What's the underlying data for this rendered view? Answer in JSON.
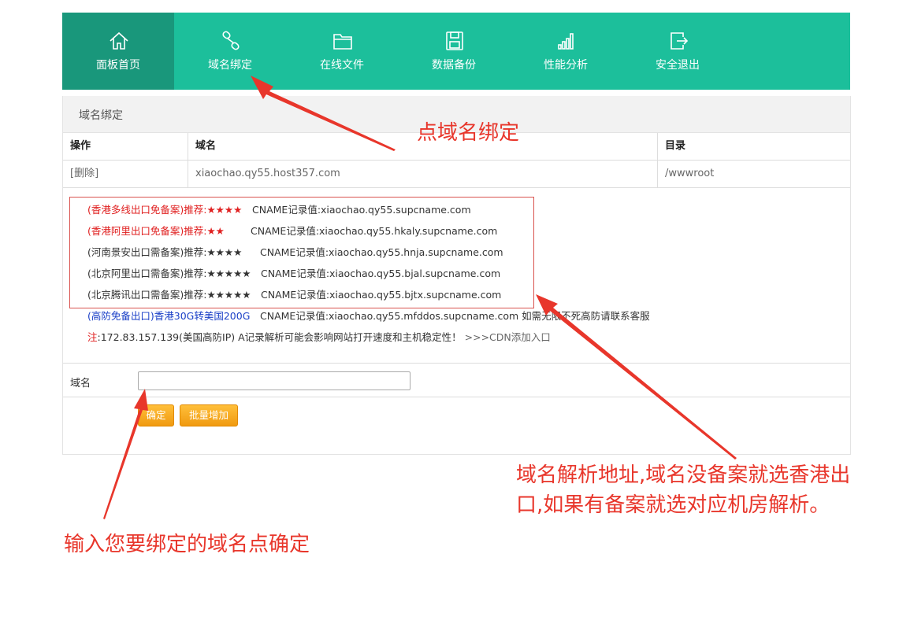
{
  "nav": {
    "items": [
      {
        "label": "面板首页",
        "icon": "home-icon"
      },
      {
        "label": "域名绑定",
        "icon": "link-icon"
      },
      {
        "label": "在线文件",
        "icon": "folder-icon"
      },
      {
        "label": "数据备份",
        "icon": "save-icon"
      },
      {
        "label": "性能分析",
        "icon": "signal-icon"
      },
      {
        "label": "安全退出",
        "icon": "logout-icon"
      }
    ],
    "active_index": 0,
    "bg_color": "#1cbf9b",
    "active_color": "#19977b"
  },
  "panel": {
    "title": "域名绑定",
    "table": {
      "headers": [
        "操作",
        "域名",
        "目录"
      ],
      "rows": [
        {
          "action": "[删除]",
          "domain": "xiaochao.qy55.host357.com",
          "dir": "/wwwroot"
        }
      ]
    },
    "cname_lines": [
      {
        "prefix": "(香港多线出口免备案)推荐:★★★★",
        "cname": "CNAME记录值:xiaochao.qy55.supcname.com",
        "color": "red"
      },
      {
        "prefix": "(香港阿里出口免备案)推荐:★★",
        "cname": "CNAME记录值:xiaochao.qy55.hkaly.supcname.com",
        "color": "red"
      },
      {
        "prefix": "(河南景安出口需备案)推荐:★★★★",
        "cname": "CNAME记录值:xiaochao.qy55.hnja.supcname.com",
        "color": "dark"
      },
      {
        "prefix": "(北京阿里出口需备案)推荐:★★★★★",
        "cname": "CNAME记录值:xiaochao.qy55.bjal.supcname.com",
        "color": "dark"
      },
      {
        "prefix": "(北京腾讯出口需备案)推荐:★★★★★",
        "cname": "CNAME记录值:xiaochao.qy55.bjtx.supcname.com",
        "color": "dark"
      }
    ],
    "ddos_line": {
      "prefix": "(高防免备出口)香港30G转美国200G",
      "cname": "CNAME记录值:xiaochao.qy55.mfddos.supcname.com 如需无限不死高防请联系客服"
    },
    "note": {
      "label": "注",
      "text": ":172.83.157.139(美国高防IP) A记录解析可能会影响网站打开速度和主机稳定性！",
      "link": ">>>CDN添加入口"
    },
    "form": {
      "domain_label": "域名",
      "domain_value": "",
      "confirm_label": "确定",
      "batch_label": "批量增加"
    }
  },
  "annotations": {
    "click_bind": "点域名绑定",
    "resolve_line1": "域名解析地址,域名没备案就选香港出",
    "resolve_line2": "口,如果有备案就选对应机房解析。",
    "enter_domain": "输入您要绑定的域名点确定"
  }
}
